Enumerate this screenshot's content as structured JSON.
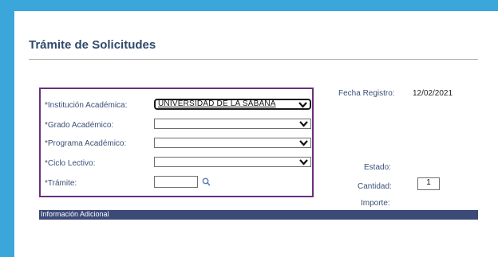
{
  "page": {
    "title": "Trámite de Solicitudes"
  },
  "form": {
    "institucion": {
      "label": "*Institución Académica:",
      "value": "UNIVERSIDAD DE LA SABANA"
    },
    "grado": {
      "label": "*Grado Académico:",
      "value": ""
    },
    "programa": {
      "label": "*Programa Académico:",
      "value": ""
    },
    "ciclo": {
      "label": "*Ciclo Lectivo:",
      "value": ""
    },
    "tramite": {
      "label": "*Trámite:",
      "value": ""
    }
  },
  "info": {
    "fecha_label": "Fecha Registro:",
    "fecha_value": "12/02/2021",
    "estado_label": "Estado:",
    "cantidad_label": "Cantidad:",
    "cantidad_value": "1",
    "importe_label": "Importe:"
  },
  "section": {
    "info_adicional": "Información Adicional"
  },
  "colors": {
    "frame": "#3aa6d9",
    "highlight": "#6b2f7c",
    "section_bar": "#3c4a78",
    "label_text": "#3a4f76"
  },
  "icons": {
    "dropdown": "chevron-down-icon",
    "lookup": "magnifier-icon"
  }
}
